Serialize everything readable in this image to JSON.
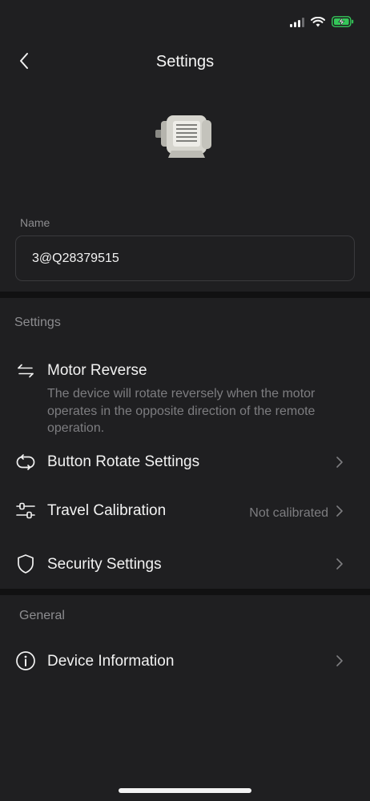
{
  "header": {
    "title": "Settings"
  },
  "device": {
    "name_label": "Name",
    "name_value": "3@Q28379515"
  },
  "settings_section": {
    "title": "Settings",
    "motor_reverse": {
      "label": "Motor Reverse",
      "description": "The device will rotate reversely when the motor operates in the opposite direction of the remote operation."
    },
    "button_rotate": {
      "label": "Button Rotate Settings"
    },
    "travel_calibration": {
      "label": "Travel Calibration",
      "value": "Not calibrated"
    },
    "security": {
      "label": "Security Settings"
    }
  },
  "general_section": {
    "title": "General",
    "device_information": {
      "label": "Device Information"
    }
  },
  "icons": {
    "status": [
      "cellular-signal-icon",
      "wifi-icon",
      "battery-charging-icon"
    ],
    "back": "chevron-left-icon",
    "motor_reverse": "swap-arrows-icon",
    "button_rotate": "rotate-loop-icon",
    "travel_calibration": "sliders-icon",
    "security": "shield-icon",
    "device_information": "info-icon",
    "row_arrow": "chevron-right-icon"
  },
  "colors": {
    "background": "#1f1f21",
    "divider": "#111112",
    "text_primary": "#f2f2f2",
    "text_secondary": "#8d8d90",
    "battery_green": "#34c759"
  }
}
